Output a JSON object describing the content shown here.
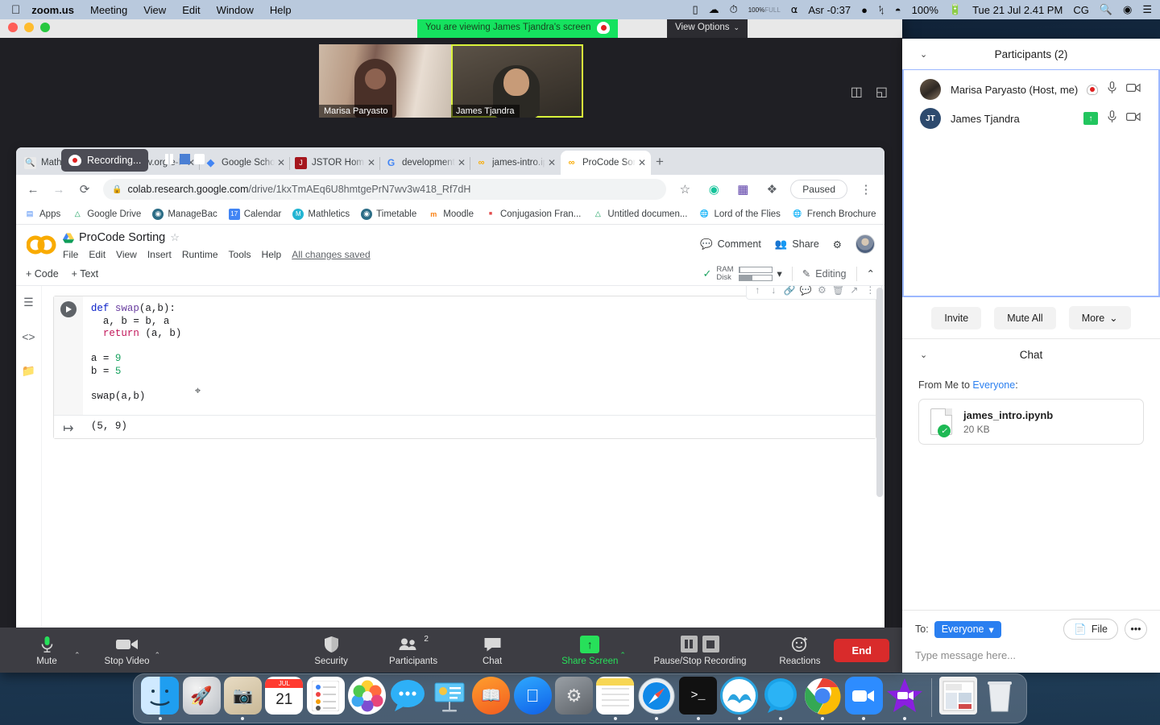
{
  "menubar": {
    "apple": "",
    "items": [
      {
        "label": "zoom.us",
        "bold": true
      },
      {
        "label": "Meeting",
        "bold": false
      },
      {
        "label": "View",
        "bold": false
      },
      {
        "label": "Edit",
        "bold": false
      },
      {
        "label": "Window",
        "bold": false
      },
      {
        "label": "Help",
        "bold": false
      }
    ],
    "battery_pct_small": "100%",
    "battery_full": "FULL",
    "prayer_timer": "Asr -0:37",
    "battery": "100%",
    "datetime": "Tue 21 Jul  2.41 PM",
    "user_initials": "CG"
  },
  "zoom_window": {
    "viewing_banner": "You are viewing James Tjandra's screen",
    "view_options": "View Options",
    "view_options_caret": "⌄",
    "tiles": [
      {
        "name": "Marisa Paryasto",
        "active": false
      },
      {
        "name": "James Tjandra",
        "active": true
      }
    ]
  },
  "browser": {
    "recording_toast": "Recording...",
    "tabs": [
      {
        "label": "Math EE James",
        "favicon": "search-favicon",
        "active": false
      },
      {
        "label": "arXiv.org e-Pri",
        "favicon": "arxiv-favicon",
        "active": false
      },
      {
        "label": "Google Schola",
        "favicon": "scholar-favicon",
        "active": false
      },
      {
        "label": "JSTOR Home",
        "favicon": "jstor-favicon",
        "active": false
      },
      {
        "label": "development ",
        "favicon": "google-favicon",
        "active": false
      },
      {
        "label": "james-intro.ip",
        "favicon": "colab-favicon",
        "active": false
      },
      {
        "label": "ProCode Sorti",
        "favicon": "colab-favicon",
        "active": true
      }
    ],
    "tab_close": "✕",
    "new_tab": "+",
    "back": "←",
    "forward": "→",
    "reload": "⟳",
    "lock": "🔒",
    "url_domain": "colab.research.google.com",
    "url_path": "/drive/1kxTmAEq6U8hmtgePrN7wv3w418_Rf7dH",
    "star": "☆",
    "paused_pill": "Paused",
    "menu_dots": "⋮",
    "bookmarks": [
      {
        "label": "Apps",
        "icon": "apps-grid-icon"
      },
      {
        "label": "Google Drive",
        "icon": "drive-icon"
      },
      {
        "label": "ManageBac",
        "icon": "managebac-icon"
      },
      {
        "label": "Calendar",
        "icon": "calendar-icon"
      },
      {
        "label": "Mathletics",
        "icon": "mathletics-icon"
      },
      {
        "label": "Timetable",
        "icon": "timetable-icon"
      },
      {
        "label": "Moodle",
        "icon": "moodle-icon"
      },
      {
        "label": "Conjugasion Fran...",
        "icon": "conjugasion-icon"
      },
      {
        "label": "Untitled documen...",
        "icon": "drive-icon"
      },
      {
        "label": "Lord of the Flies",
        "icon": "globe-icon"
      },
      {
        "label": "French Brochure",
        "icon": "globe-icon"
      }
    ],
    "bookmarks_overflow": "»"
  },
  "colab": {
    "logo": "CO",
    "title": "ProCode Sorting",
    "star": "☆",
    "menus": [
      "File",
      "Edit",
      "View",
      "Insert",
      "Runtime",
      "Tools",
      "Help"
    ],
    "saved_status": "All changes saved",
    "comment": "Comment",
    "share": "Share",
    "settings_icon": "gear-icon",
    "toolbar": {
      "add_code": "+ Code",
      "add_text": "+ Text",
      "ram_label": "RAM",
      "disk_label": "Disk",
      "connect_caret": "▾",
      "editing": "Editing",
      "collapse_caret": "⌃"
    },
    "cell": {
      "code_lines": [
        "def swap(a,b):",
        "  a, b = b, a",
        "  return (a, b)",
        "",
        "a = 9",
        "b = 5",
        "",
        "swap(a,b)"
      ],
      "output": "(5, 9)",
      "toolbar_icons": [
        "move-up-icon",
        "move-down-icon",
        "link-icon",
        "comment-icon",
        "settings-icon",
        "delete-icon",
        "open-new-icon",
        "more-icon"
      ]
    }
  },
  "zoom_controls": {
    "mute": "Mute",
    "stop_video": "Stop Video",
    "security": "Security",
    "participants": "Participants",
    "participants_count": "2",
    "chat": "Chat",
    "share_screen": "Share Screen",
    "pause_stop_recording": "Pause/Stop Recording",
    "reactions": "Reactions",
    "end": "End",
    "caret": "⌃"
  },
  "participants_panel": {
    "title": "Participants (2)",
    "collapse_caret": "⌄",
    "rows": [
      {
        "name": "Marisa Paryasto (Host, me)",
        "avatar_type": "photo",
        "initials": "",
        "recording": true,
        "sharing": false
      },
      {
        "name": "James Tjandra",
        "avatar_type": "initials",
        "initials": "JT",
        "recording": false,
        "sharing": true
      }
    ],
    "invite": "Invite",
    "mute_all": "Mute All",
    "more": "More",
    "more_caret": "⌄"
  },
  "chat_panel": {
    "title": "Chat",
    "collapse_caret": "⌄",
    "from_prefix": "From Me to ",
    "from_target": "Everyone",
    "from_suffix": ":",
    "file_name": "james_intro.ipynb",
    "file_size": "20 KB",
    "to_label": "To:",
    "to_value": "Everyone",
    "to_caret": "▾",
    "file_button": "File",
    "more_button": "•••",
    "placeholder": "Type message here..."
  },
  "dock": {
    "apps": [
      {
        "name": "finder",
        "running": true
      },
      {
        "name": "launchpad",
        "running": false
      },
      {
        "name": "preview",
        "running": true
      },
      {
        "name": "calendar",
        "running": false,
        "month": "JUL",
        "day": "21"
      },
      {
        "name": "reminders",
        "running": false
      },
      {
        "name": "photos",
        "running": false
      },
      {
        "name": "messages",
        "running": false
      },
      {
        "name": "keynote",
        "running": false
      },
      {
        "name": "ibooks",
        "running": false
      },
      {
        "name": "app-store",
        "running": false
      },
      {
        "name": "system-preferences",
        "running": false
      },
      {
        "name": "notes",
        "running": true
      },
      {
        "name": "safari",
        "running": true
      },
      {
        "name": "terminal",
        "running": true
      },
      {
        "name": "anaconda",
        "running": true
      },
      {
        "name": "skype",
        "running": true
      },
      {
        "name": "chrome",
        "running": true
      },
      {
        "name": "zoom",
        "running": true
      },
      {
        "name": "imovie",
        "running": true
      },
      {
        "name": "downloads-stack",
        "running": false
      },
      {
        "name": "trash",
        "running": false
      }
    ]
  },
  "colors": {
    "zoom_green": "#15e25f",
    "share_green": "#27e05a",
    "end_red": "#d92b2b",
    "chrome_tabstrip": "#dee1e6",
    "colab_orange": "#f9ab00",
    "chat_blue": "#2a7ff0"
  }
}
